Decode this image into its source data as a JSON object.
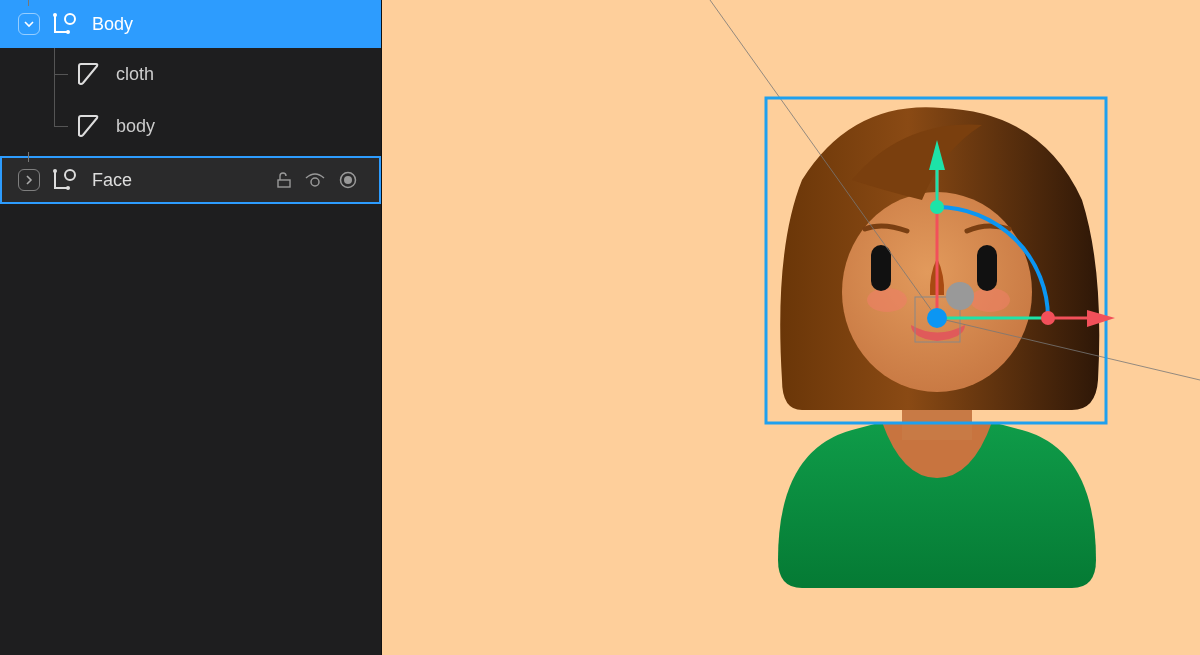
{
  "layers": [
    {
      "name": "Body",
      "kind": "group",
      "expanded": true,
      "selected": true,
      "hovered": false,
      "children": [
        {
          "name": "cloth",
          "kind": "mesh",
          "selected": false
        },
        {
          "name": "body",
          "kind": "mesh",
          "selected": false
        }
      ]
    },
    {
      "name": "Face",
      "kind": "group",
      "expanded": false,
      "selected": false,
      "hovered": true
    }
  ]
}
